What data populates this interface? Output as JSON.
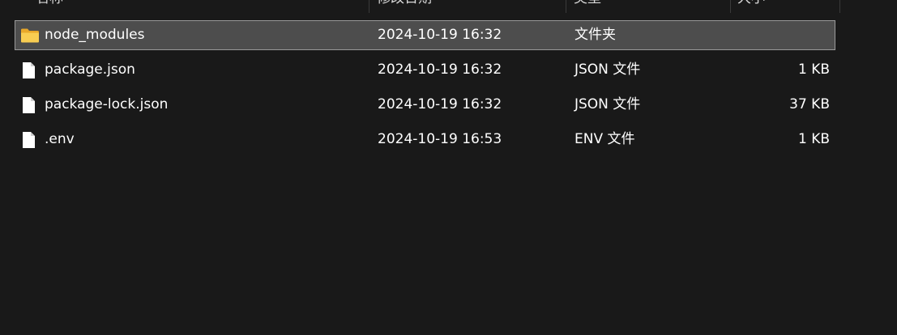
{
  "columns": {
    "name": "名称",
    "date": "修改日期",
    "type": "类型",
    "size": "大小"
  },
  "files": [
    {
      "name": "node_modules",
      "date": "2024-10-19 16:32",
      "type": "文件夹",
      "size": "",
      "icon": "folder-icon",
      "selected": true
    },
    {
      "name": "package.json",
      "date": "2024-10-19 16:32",
      "type": "JSON 文件",
      "size": "1 KB",
      "icon": "file-icon",
      "selected": false
    },
    {
      "name": "package-lock.json",
      "date": "2024-10-19 16:32",
      "type": "JSON 文件",
      "size": "37 KB",
      "icon": "file-icon",
      "selected": false
    },
    {
      "name": ".env",
      "date": "2024-10-19 16:53",
      "type": "ENV 文件",
      "size": "1 KB",
      "icon": "file-icon",
      "selected": false
    }
  ],
  "colors": {
    "background": "#191919",
    "selected_row": "#4d4d4d",
    "selected_border": "#9a9a9a",
    "folder": "#f5c542"
  }
}
